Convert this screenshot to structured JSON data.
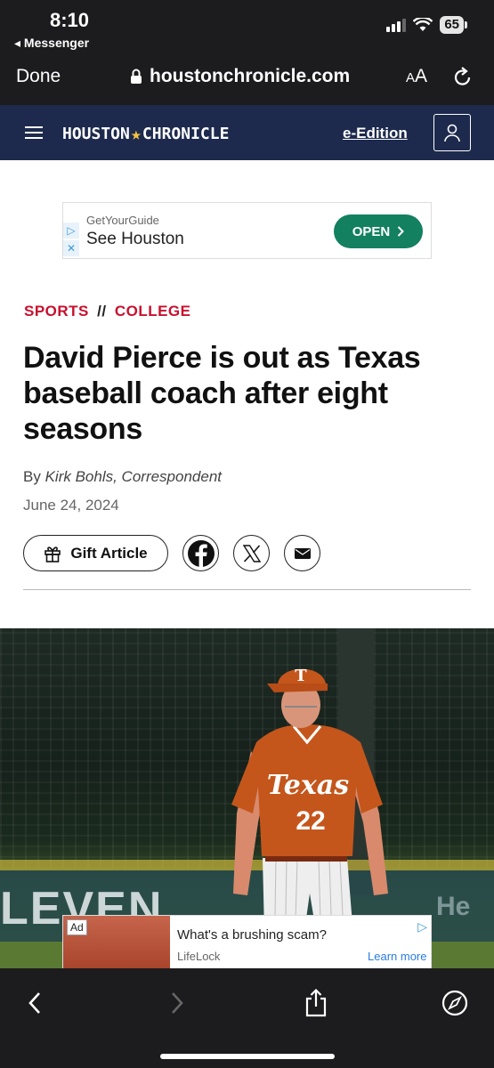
{
  "status_bar": {
    "time": "8:10",
    "back_app": "◂ Messenger",
    "battery": "65"
  },
  "browser": {
    "done_label": "Done",
    "url": "houstonchronicle.com",
    "aa_label": "A",
    "aa_label_big": "A"
  },
  "site_header": {
    "logo_left": "HOUSTON",
    "logo_star": "★",
    "logo_right": "CHRONICLE",
    "eedition_label": "e-Edition"
  },
  "ad_top": {
    "brand": "GetYourGuide",
    "headline": "See Houston",
    "cta": "OPEN",
    "adchoice_play": "▷",
    "adchoice_close": "✕"
  },
  "article": {
    "kicker_section": "SPORTS",
    "kicker_sep": "//",
    "kicker_sub": "COLLEGE",
    "title": "David Pierce is out as Texas baseball coach after eight seasons",
    "byline_prefix": "By",
    "byline_author": "Kirk Bohls, Correspondent",
    "date": "June 24, 2024",
    "gift_label": "Gift Article"
  },
  "hero_photo": {
    "banner_text": "LEVEN",
    "banner_text2": "He",
    "jersey_text": "Texas",
    "jersey_number": "22",
    "cap_letter": "T"
  },
  "ad_bottom": {
    "badge": "Ad",
    "headline": "What's a brushing scam?",
    "sponsor": "LifeLock",
    "cta": "Learn more",
    "adchoice": "▷"
  },
  "colors": {
    "header_navy": "#1d2a4d",
    "kicker_red": "#c8102e",
    "open_green": "#138060",
    "toolbar": "#1c1c1e"
  }
}
